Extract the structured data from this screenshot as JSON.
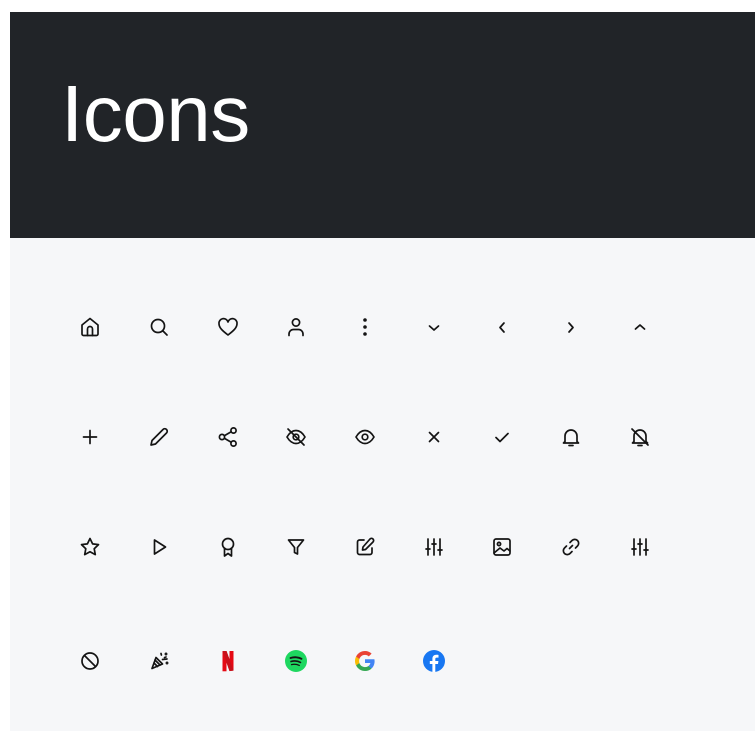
{
  "header": {
    "title": "Icons",
    "background": "#212428",
    "text_color": "#ffffff"
  },
  "content": {
    "background": "#f6f7f9",
    "icon_color": "#141414"
  },
  "icons": [
    [
      "home-icon",
      "search-icon",
      "heart-icon",
      "user-icon",
      "more-vertical-icon",
      "chevron-down-icon",
      "chevron-left-icon",
      "chevron-right-icon",
      "chevron-up-icon"
    ],
    [
      "plus-icon",
      "pencil-icon",
      "share-icon",
      "eye-off-icon",
      "eye-icon",
      "close-icon",
      "check-icon",
      "bell-icon",
      "bell-off-icon"
    ],
    [
      "star-icon",
      "play-icon",
      "award-icon",
      "filter-icon",
      "edit-icon",
      "sliders-icon",
      "image-icon",
      "link-icon",
      "sliders-icon"
    ],
    [
      "ban-icon",
      "confetti-icon",
      "netflix-logo-icon",
      "spotify-logo-icon",
      "google-logo-icon",
      "facebook-logo-icon"
    ]
  ],
  "brand_colors": {
    "netflix": "#e50914",
    "spotify": "#1ed760",
    "google_blue": "#4285f4",
    "google_red": "#ea4335",
    "google_yellow": "#fbbc05",
    "google_green": "#34a853",
    "facebook": "#1877f2"
  }
}
